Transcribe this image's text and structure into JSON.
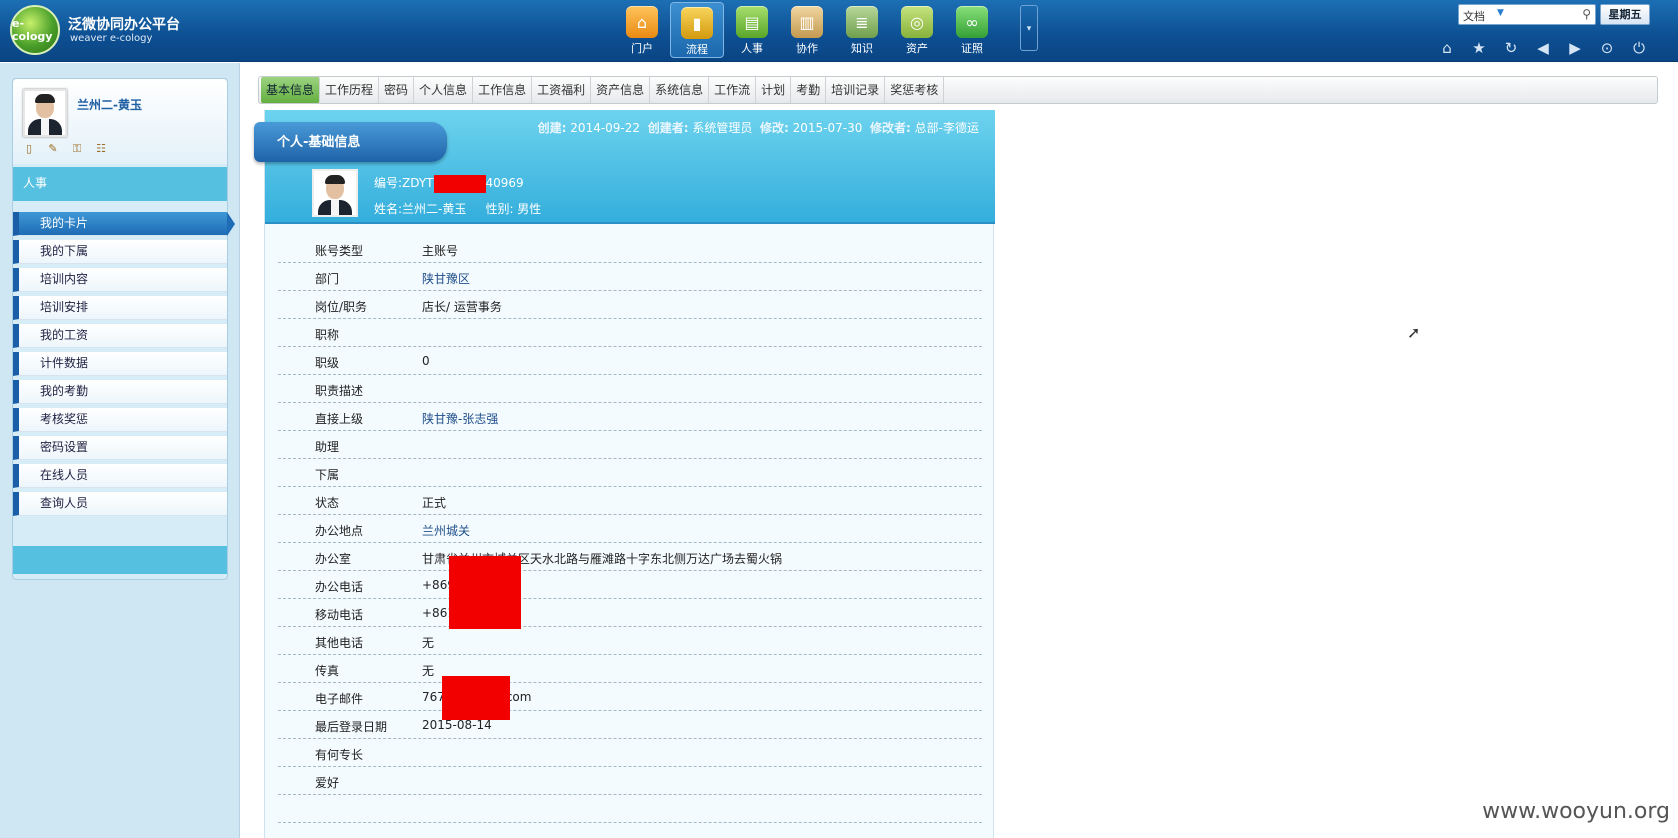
{
  "app": {
    "logo_text": "e-cology",
    "brand_title": "泛微协同办公平台",
    "brand_sub": "weaver e-cology"
  },
  "mainnav": [
    {
      "label": "门户",
      "icon": "home-icon",
      "glyph": "⌂"
    },
    {
      "label": "流程",
      "icon": "chart-icon",
      "glyph": "▮",
      "active": true
    },
    {
      "label": "人事",
      "icon": "hr-icon",
      "glyph": "▤"
    },
    {
      "label": "协作",
      "icon": "clipboard-icon",
      "glyph": "▥"
    },
    {
      "label": "知识",
      "icon": "knowledge-icon",
      "glyph": "≣"
    },
    {
      "label": "资产",
      "icon": "coins-icon",
      "glyph": "◎"
    },
    {
      "label": "证照",
      "icon": "infinity-icon",
      "glyph": "∞"
    }
  ],
  "search": {
    "scope": "文档"
  },
  "weekday": "星期五",
  "toolbar_icons": [
    "home-icon",
    "star-icon",
    "refresh-icon",
    "back-icon",
    "forward-icon",
    "download-icon",
    "power-icon"
  ],
  "sidebar": {
    "user_name": "兰州二-黄玉",
    "module": "人事",
    "items": [
      {
        "label": "我的卡片",
        "active": true
      },
      {
        "label": "我的下属"
      },
      {
        "label": "培训内容"
      },
      {
        "label": "培训安排"
      },
      {
        "label": "我的工资"
      },
      {
        "label": "计件数据"
      },
      {
        "label": "我的考勤"
      },
      {
        "label": "考核奖惩"
      },
      {
        "label": "密码设置"
      },
      {
        "label": "在线人员"
      },
      {
        "label": "查询人员"
      }
    ]
  },
  "tabs": [
    "基本信息",
    "工作历程",
    "密码",
    "个人信息",
    "工作信息",
    "工资福利",
    "资产信息",
    "系统信息",
    "工作流",
    "计划",
    "考勤",
    "培训记录",
    "奖惩考核"
  ],
  "card": {
    "title": "个人-基础信息",
    "created_label": "创建:",
    "created": "2014-09-22",
    "creator_label": "创建者:",
    "creator": "系统管理员",
    "modified_label": "修改:",
    "modified": "2015-07-30",
    "modifier_label": "修改者:",
    "modifier": "总部-李德运",
    "emp_no_prefix": "编号:ZDYT",
    "emp_no_suffix": "40969",
    "name_label": "姓名:兰州二-黄玉",
    "gender_label": "性别: 男性"
  },
  "fields": [
    {
      "label": "账号类型",
      "value": "主账号"
    },
    {
      "label": "部门",
      "value": "陕甘豫区",
      "link": true
    },
    {
      "label": "岗位/职务",
      "value": "店长/ 运营事务"
    },
    {
      "label": "职称",
      "value": ""
    },
    {
      "label": "职级",
      "value": "0"
    },
    {
      "label": "职责描述",
      "value": ""
    },
    {
      "label": "直接上级",
      "value": "陕甘豫-张志强",
      "link": true
    },
    {
      "label": "助理",
      "value": ""
    },
    {
      "label": "下属",
      "value": ""
    },
    {
      "label": "状态",
      "value": "正式"
    },
    {
      "label": "办公地点",
      "value": "兰州城关",
      "link": true
    },
    {
      "label": "办公室",
      "value": "甘肃省兰州市城关区天水北路与雁滩路十字东北侧万达广场去蜀火锅"
    },
    {
      "label": "办公电话",
      "value": "+869"
    },
    {
      "label": "移动电话",
      "value": "+861"
    },
    {
      "label": "其他电话",
      "value": "无"
    },
    {
      "label": "传真",
      "value": "无"
    },
    {
      "label": "电子邮件",
      "value": "767",
      "suffix": ".com"
    },
    {
      "label": "最后登录日期",
      "value": "2015-08-14"
    },
    {
      "label": "有何专长",
      "value": ""
    },
    {
      "label": "爱好",
      "value": ""
    }
  ],
  "watermark": "www.wooyun.org"
}
